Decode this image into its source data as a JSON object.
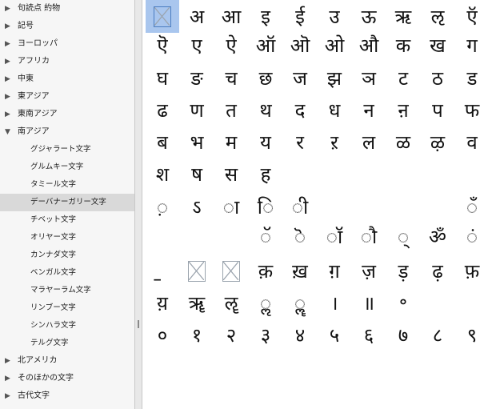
{
  "sidebar": {
    "items": [
      {
        "label": "句読点 約物",
        "expanded": false,
        "child": false,
        "selected": false
      },
      {
        "label": "記号",
        "expanded": false,
        "child": false,
        "selected": false
      },
      {
        "label": "ヨーロッパ",
        "expanded": false,
        "child": false,
        "selected": false
      },
      {
        "label": "アフリカ",
        "expanded": false,
        "child": false,
        "selected": false
      },
      {
        "label": "中東",
        "expanded": false,
        "child": false,
        "selected": false
      },
      {
        "label": "東アジア",
        "expanded": false,
        "child": false,
        "selected": false
      },
      {
        "label": "東南アジア",
        "expanded": false,
        "child": false,
        "selected": false
      },
      {
        "label": "南アジア",
        "expanded": true,
        "child": false,
        "selected": false
      },
      {
        "label": "グジャラート文字",
        "child": true,
        "selected": false
      },
      {
        "label": "グルムキー文字",
        "child": true,
        "selected": false
      },
      {
        "label": "タミール文字",
        "child": true,
        "selected": false
      },
      {
        "label": "デーバナーガリー文字",
        "child": true,
        "selected": true
      },
      {
        "label": "チベット文字",
        "child": true,
        "selected": false
      },
      {
        "label": "オリヤー文字",
        "child": true,
        "selected": false
      },
      {
        "label": "カンナダ文字",
        "child": true,
        "selected": false
      },
      {
        "label": "ベンガル文字",
        "child": true,
        "selected": false
      },
      {
        "label": "マラヤーラム文字",
        "child": true,
        "selected": false
      },
      {
        "label": "リンブー文字",
        "child": true,
        "selected": false
      },
      {
        "label": "シンハラ文字",
        "child": true,
        "selected": false
      },
      {
        "label": "テルグ文字",
        "child": true,
        "selected": false
      },
      {
        "label": "北アメリカ",
        "expanded": false,
        "child": false,
        "selected": false
      },
      {
        "label": "そのほかの文字",
        "expanded": false,
        "child": false,
        "selected": false
      },
      {
        "label": "古代文字",
        "expanded": false,
        "child": false,
        "selected": false
      }
    ],
    "triangle_collapsed": "▶",
    "triangle_expanded": "▼"
  },
  "grid": {
    "rows": [
      [
        "[box]",
        "अ",
        "आ",
        "इ",
        "ई",
        "उ",
        "ऊ",
        "ऋ",
        "ऌ",
        "ऍ"
      ],
      [
        "ऎ",
        "ए",
        "ऐ",
        "ऑ",
        "ऒ",
        "ओ",
        "औ",
        "क",
        "ख",
        "ग"
      ],
      [
        "घ",
        "ङ",
        "च",
        "छ",
        "ज",
        "झ",
        "ञ",
        "ट",
        "ठ",
        "ड"
      ],
      [
        "ढ",
        "ण",
        "त",
        "थ",
        "द",
        "ध",
        "न",
        "ऩ",
        "प",
        "फ"
      ],
      [
        "ब",
        "भ",
        "म",
        "य",
        "र",
        "ऱ",
        "ल",
        "ळ",
        "ऴ",
        "व"
      ],
      [
        "श",
        "ष",
        "स",
        "ह",
        "",
        "",
        "",
        "",
        "",
        ""
      ],
      [
        "़",
        "ऽ",
        "ा",
        "ि",
        "ी",
        "",
        "",
        "",
        "",
        "ँ"
      ],
      [
        "",
        "",
        "",
        "ॅ",
        "ॆ",
        "ॉ",
        "ौ",
        "्",
        "ॐ",
        "ं"
      ],
      [
        "॒",
        "[box]",
        "[box]",
        "क़",
        "ख़",
        "ग़",
        "ज़",
        "ड़",
        "ढ़",
        "फ़"
      ],
      [
        "य़",
        "ॠ",
        "ॡ",
        "ॢ",
        "ॣ",
        "।",
        "॥",
        "॰",
        "",
        ""
      ],
      [
        "०",
        "१",
        "२",
        "३",
        "४",
        "५",
        "६",
        "७",
        "८",
        "९"
      ]
    ],
    "selected_cell": "0-0",
    "missing_glyph_icon": "missing-glyph-icon"
  },
  "colors": {
    "sidebar_bg": "#f6f6f6",
    "selected_row": "#d9d9d9",
    "selected_cell": "#a9c6ee"
  }
}
